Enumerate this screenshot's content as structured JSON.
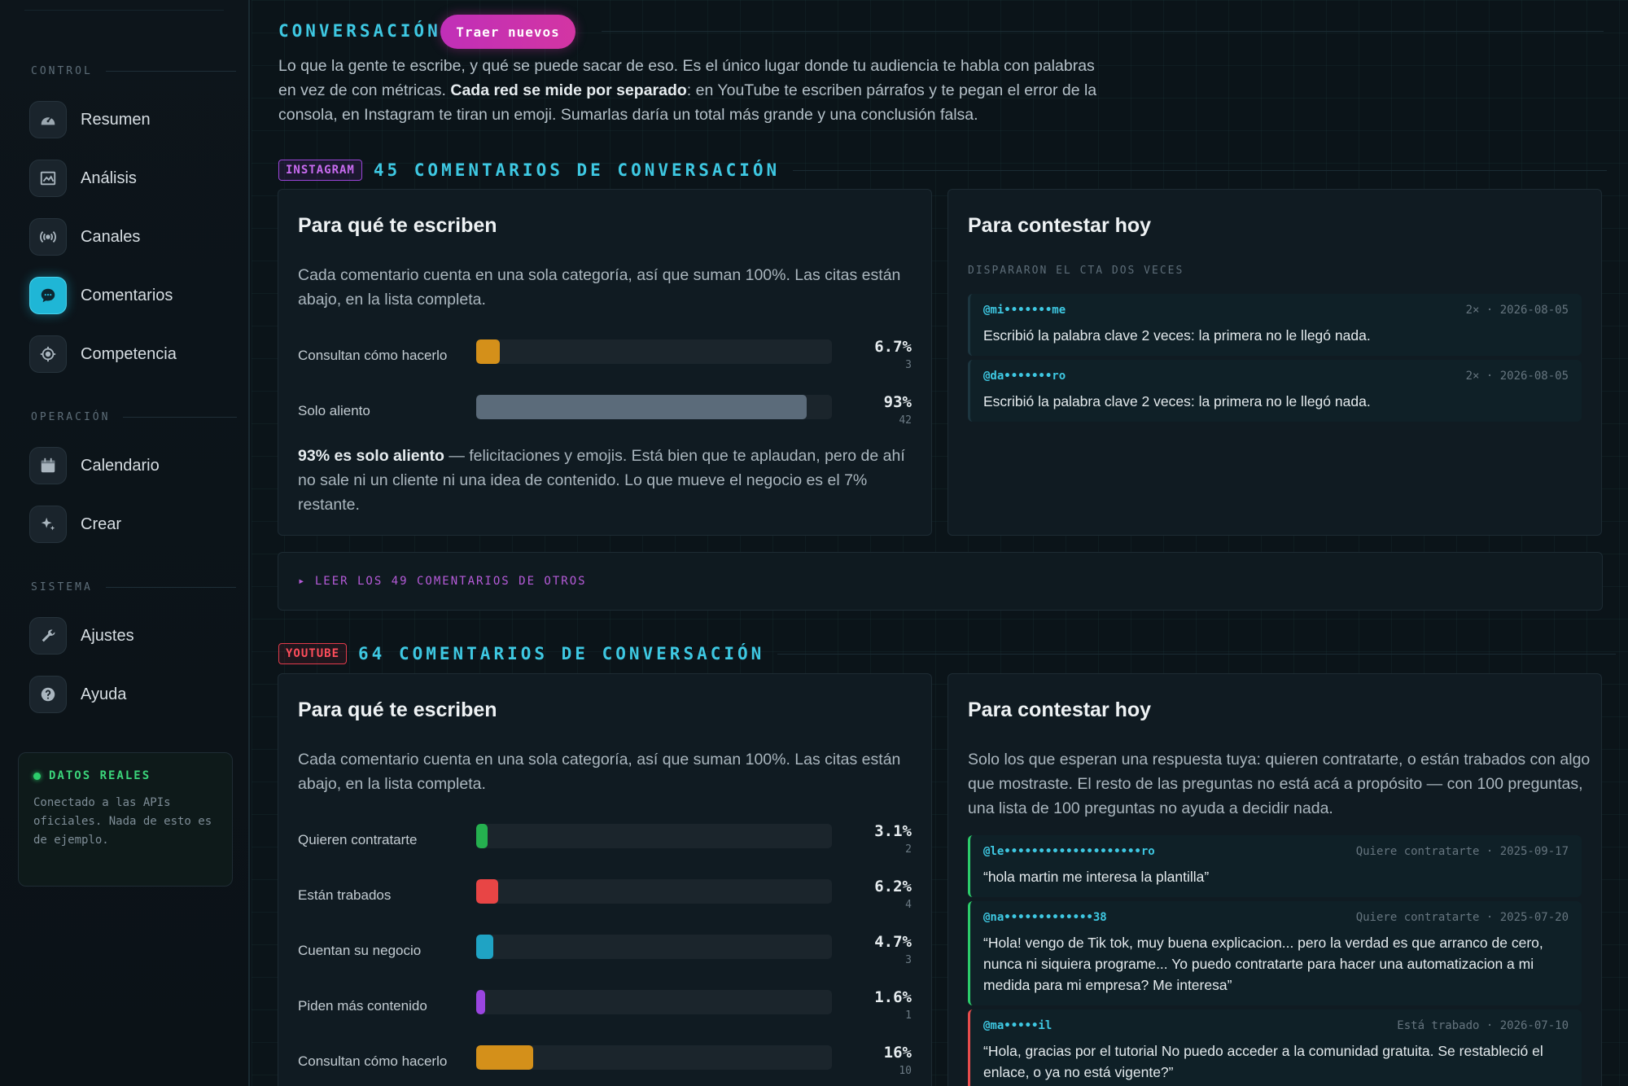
{
  "sidebar": {
    "sections": [
      {
        "label": "CONTROL"
      },
      {
        "label": "OPERACIÓN"
      },
      {
        "label": "SISTEMA"
      }
    ],
    "items": [
      {
        "label": "Resumen",
        "icon": "dashboard-icon"
      },
      {
        "label": "Análisis",
        "icon": "image-chart-icon"
      },
      {
        "label": "Canales",
        "icon": "broadcast-icon"
      },
      {
        "label": "Comentarios",
        "icon": "chat-bubble-icon",
        "active": true
      },
      {
        "label": "Competencia",
        "icon": "target-icon"
      },
      {
        "label": "Calendario",
        "icon": "calendar-icon"
      },
      {
        "label": "Crear",
        "icon": "sparkle-icon"
      },
      {
        "label": "Ajustes",
        "icon": "wrench-icon"
      },
      {
        "label": "Ayuda",
        "icon": "help-icon"
      }
    ],
    "status": {
      "title": "DATOS REALES",
      "text": "Conectado a las APIs oficiales. Nada de esto es de ejemplo."
    }
  },
  "header": {
    "title": "CONVERSACIÓN",
    "fetch_button": "Traer nuevos",
    "intro_1": "Lo que la gente te escribe, y qué se puede sacar de eso. Es el único lugar donde tu audiencia te habla con palabras en vez de con métricas. ",
    "intro_bold": "Cada red se mide por separado",
    "intro_2": ": en YouTube te escriben párrafos y te pegan el error de la consola, en Instagram te tiran un emoji. Sumarlas daría un total más grande y una conclusión falsa."
  },
  "instagram": {
    "badge": "INSTAGRAM",
    "title": "45 COMENTARIOS DE CONVERSACIÓN",
    "why_title": "Para qué te escriben",
    "why_desc": "Cada comentario cuenta en una sola categoría, así que suman 100%. Las citas están abajo, en la lista completa.",
    "bars": [
      {
        "label": "Consultan cómo hacerlo",
        "pct": "6.7%",
        "count": "3",
        "value": 6.7,
        "color": "#d4901a"
      },
      {
        "label": "Solo aliento",
        "pct": "93%",
        "count": "42",
        "value": 93,
        "color": "#5b6b7a"
      }
    ],
    "summary_bold": "93% es solo aliento",
    "summary_rest": " — felicitaciones y emojis. Está bien que te aplaudan, pero de ahí no sale ni un cliente ni una idea de contenido. Lo que mueve el negocio es el 7% restante.",
    "reply_title": "Para contestar hoy",
    "reply_caption": "DISPARARON EL CTA DOS VECES",
    "quotes": [
      {
        "user": "@mi•••••••me",
        "meta": "2× · 2026-08-05",
        "text": "Escribió la palabra clave 2 veces: la primera no le llegó nada."
      },
      {
        "user": "@da•••••••ro",
        "meta": "2× · 2026-08-05",
        "text": "Escribió la palabra clave 2 veces: la primera no le llegó nada."
      }
    ],
    "expander": "▸ LEER LOS 49 COMENTARIOS DE OTROS"
  },
  "youtube": {
    "badge": "YOUTUBE",
    "title": "64 COMENTARIOS DE CONVERSACIÓN",
    "why_title": "Para qué te escriben",
    "why_desc": "Cada comentario cuenta en una sola categoría, así que suman 100%. Las citas están abajo, en la lista completa.",
    "bars": [
      {
        "label": "Quieren contratarte",
        "pct": "3.1%",
        "count": "2",
        "value": 3.1,
        "color": "#25b04f"
      },
      {
        "label": "Están trabados",
        "pct": "6.2%",
        "count": "4",
        "value": 6.2,
        "color": "#e84545"
      },
      {
        "label": "Cuentan su negocio",
        "pct": "4.7%",
        "count": "3",
        "value": 4.7,
        "color": "#1fa3c4"
      },
      {
        "label": "Piden más contenido",
        "pct": "1.6%",
        "count": "1",
        "value": 1.6,
        "color": "#9a45e0"
      },
      {
        "label": "Consultan cómo hacerlo",
        "pct": "16%",
        "count": "10",
        "value": 16,
        "color": "#d4901a"
      }
    ],
    "reply_title": "Para contestar hoy",
    "reply_desc": "Solo los que esperan una respuesta tuya: quieren contratarte, o están trabados con algo que mostraste. El resto de las preguntas no está acá a propósito — con 100 preguntas, una lista de 100 preguntas no ayuda a decidir nada.",
    "quotes": [
      {
        "user": "@le••••••••••••••••••••ro",
        "meta": "Quiere contratarte · 2025-09-17",
        "text": "“hola martin me interesa la plantilla”",
        "tone": "green"
      },
      {
        "user": "@na•••••••••••••38",
        "meta": "Quiere contratarte · 2025-07-20",
        "text": "“Hola! vengo de Tik tok, muy buena explicacion... pero la verdad es que arranco de cero, nunca ni siquiera programe... Yo puedo contratarte para hacer una automatizacion a mi medida para mi empresa? Me interesa”",
        "tone": "green"
      },
      {
        "user": "@ma•••••il",
        "meta": "Está trabado · 2026-07-10",
        "text": "“Hola, gracias por el tutorial No puedo acceder a la comunidad gratuita. Se restableció el enlace, o ya no está vigente?”",
        "tone": "red"
      }
    ]
  }
}
